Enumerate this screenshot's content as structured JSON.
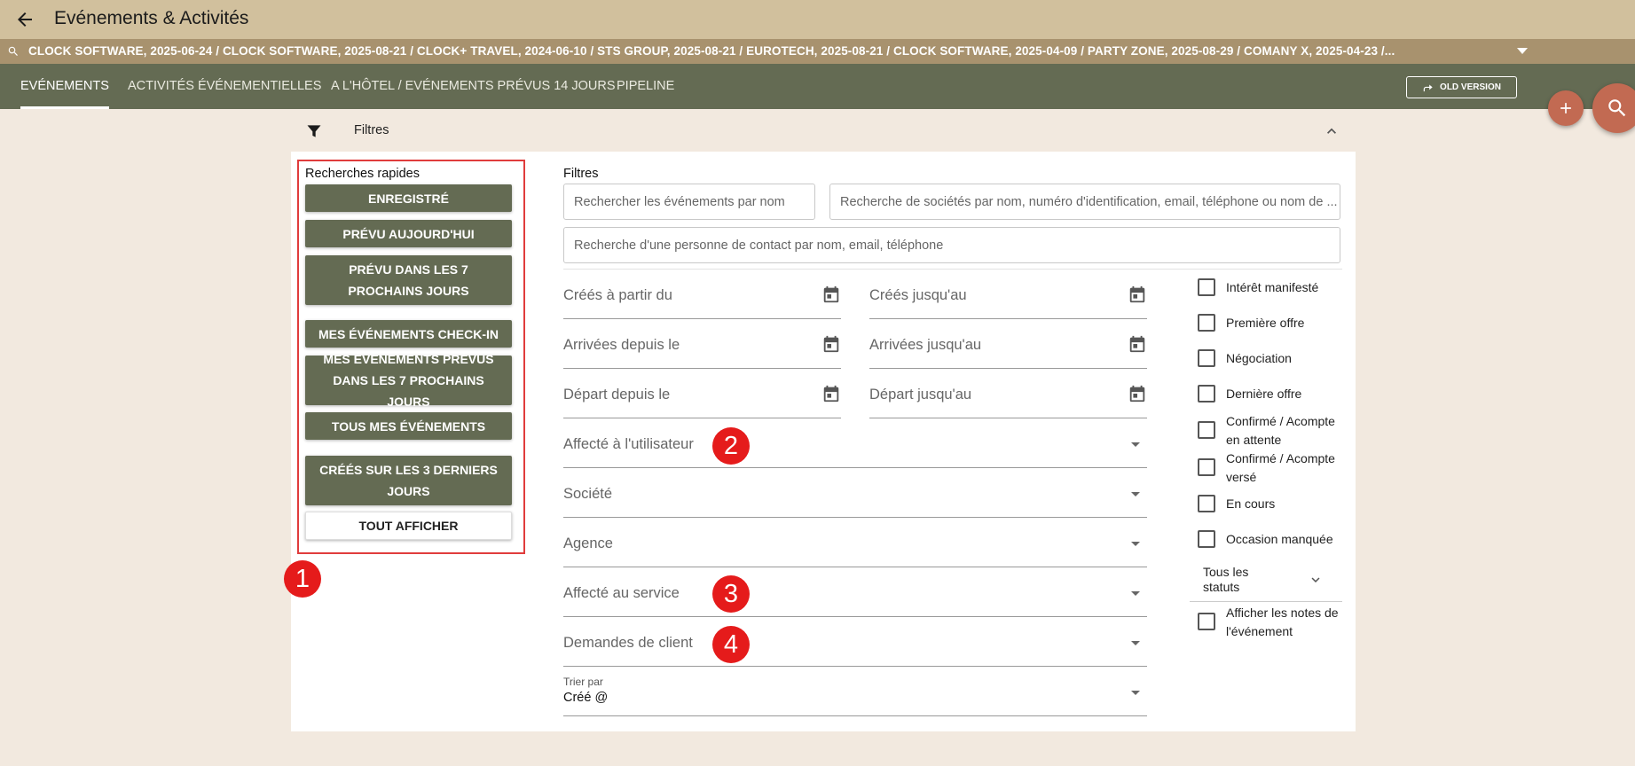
{
  "app": {
    "title": "Evénements & Activités"
  },
  "breadcrumbs": {
    "text": "CLOCK SOFTWARE, 2025-06-24  /  CLOCK SOFTWARE, 2025-08-21  /  CLOCK+ TRAVEL, 2024-06-10  /  STS GROUP, 2025-08-21  /  EUROTECH, 2025-08-21  /  CLOCK SOFTWARE, 2025-04-09  /  PARTY ZONE, 2025-08-29  /  COMANY X, 2025-04-23  /..."
  },
  "nav": {
    "tabs": [
      {
        "label": "Evénements"
      },
      {
        "label": "Activités événementielles"
      },
      {
        "label": "A l'hôtel / Evénements prévus 14 jours"
      },
      {
        "label": "Pipeline"
      }
    ],
    "old_version_label": "OLD VERSION"
  },
  "filter_panel": {
    "title": "Filtres"
  },
  "quick_searches": {
    "title": "Recherches rapides",
    "buttons": [
      {
        "label": "Enregistré"
      },
      {
        "label": "Prévu aujourd'hui"
      },
      {
        "label": "Prévu dans les 7 prochains jours"
      },
      {
        "label": "Mes événements check-in"
      },
      {
        "label": "Mes événements prévus dans les 7 prochains jours"
      },
      {
        "label": "Tous mes événements"
      },
      {
        "label": "Créés sur les 3 derniers jours"
      },
      {
        "label": "Tout afficher"
      }
    ]
  },
  "filters": {
    "label": "Filtres",
    "search_events_placeholder": "Rechercher les événements par nom",
    "search_companies_placeholder": "Recherche de sociétés par nom, numéro d'identification, email, téléphone ou nom de ...",
    "search_contact_placeholder": "Recherche d'une personne de contact par nom, email, téléphone",
    "dates": [
      {
        "label": "Créés à partir du"
      },
      {
        "label": "Créés jusqu'au"
      },
      {
        "label": "Arrivées depuis le"
      },
      {
        "label": "Arrivées jusqu'au"
      },
      {
        "label": "Départ depuis le"
      },
      {
        "label": "Départ jusqu'au"
      }
    ],
    "selects": [
      {
        "label": "Affecté à l'utilisateur"
      },
      {
        "label": "Société"
      },
      {
        "label": "Agence"
      },
      {
        "label": "Affecté au service"
      },
      {
        "label": "Demandes de client"
      }
    ],
    "sort": {
      "label": "Trier par",
      "value": "Créé @"
    }
  },
  "statuses": {
    "items": [
      {
        "label": "Intérêt manifesté"
      },
      {
        "label": "Première offre"
      },
      {
        "label": "Négociation"
      },
      {
        "label": "Dernière offre"
      },
      {
        "label": "Confirmé / Acompte en attente"
      },
      {
        "label": "Confirmé / Acompte versé"
      },
      {
        "label": "En cours"
      },
      {
        "label": "Occasion manquée"
      }
    ],
    "all_statuses_label": "Tous les statuts",
    "show_notes_label": "Afficher les notes de l'événement"
  },
  "annotations": {
    "badges": [
      "1",
      "2",
      "3",
      "4"
    ]
  }
}
